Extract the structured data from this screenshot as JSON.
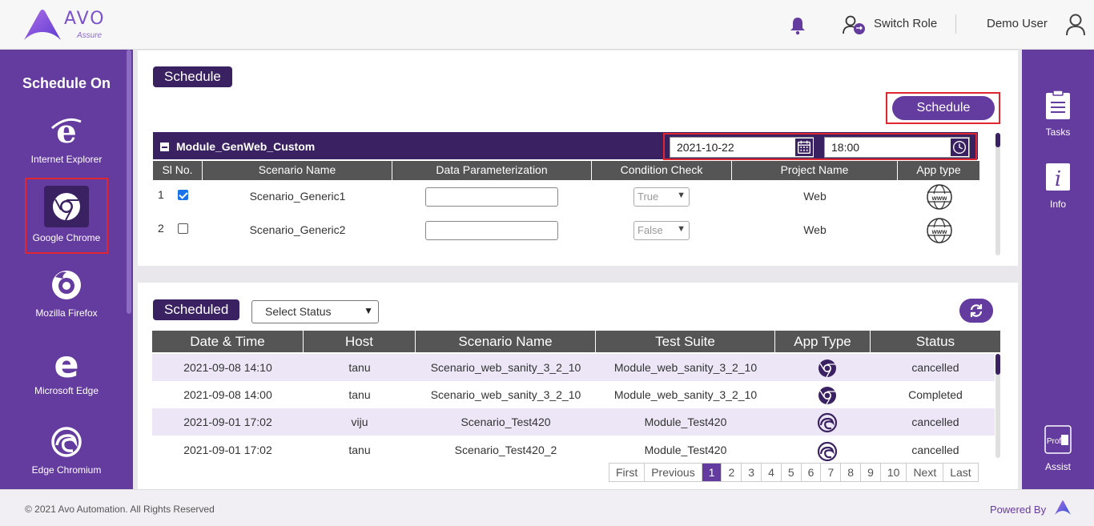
{
  "header": {
    "logo_text": "AVO",
    "logo_sub": "Assure",
    "switch_role": "Switch Role",
    "user_name": "Demo User"
  },
  "left_sidebar": {
    "title": "Schedule On",
    "browsers": [
      {
        "label": "Internet Explorer",
        "icon": "internet-explorer-icon"
      },
      {
        "label": "Google Chrome",
        "icon": "chrome-icon",
        "selected": true
      },
      {
        "label": "Mozilla Firefox",
        "icon": "firefox-icon"
      },
      {
        "label": "Microsoft Edge",
        "icon": "edge-icon"
      },
      {
        "label": "Edge Chromium",
        "icon": "edge-chromium-icon"
      }
    ]
  },
  "right_sidebar": {
    "items": [
      {
        "label": "Tasks",
        "icon": "clipboard-icon"
      },
      {
        "label": "Info",
        "icon": "info-icon"
      },
      {
        "label": "Assist",
        "icon": "proficient-icon",
        "icon_text": "Prof"
      }
    ]
  },
  "schedule_section": {
    "title": "Schedule",
    "schedule_button": "Schedule",
    "module_name": "Module_GenWeb_Custom",
    "date": "2021-10-22",
    "time": "18:00",
    "columns": [
      "Sl No.",
      "Scenario Name",
      "Data Parameterization",
      "Condition Check",
      "Project Name",
      "App type"
    ],
    "rows": [
      {
        "sl": "1",
        "checked": true,
        "scenario": "Scenario_Generic1",
        "data_param": "",
        "condition": "True",
        "project": "Web",
        "app_type": "www"
      },
      {
        "sl": "2",
        "checked": false,
        "scenario": "Scenario_Generic2",
        "data_param": "",
        "condition": "False",
        "project": "Web",
        "app_type": "www"
      }
    ]
  },
  "scheduled_section": {
    "title": "Scheduled",
    "status_select": "Select Status",
    "columns": [
      "Date & Time",
      "Host",
      "Scenario Name",
      "Test Suite",
      "App Type",
      "Status"
    ],
    "rows": [
      {
        "datetime": "2021-09-08 14:10",
        "host": "tanu",
        "scenario": "Scenario_web_sanity_3_2_10",
        "suite": "Module_web_sanity_3_2_10",
        "app": "chrome",
        "status": "cancelled"
      },
      {
        "datetime": "2021-09-08 14:00",
        "host": "tanu",
        "scenario": "Scenario_web_sanity_3_2_10",
        "suite": "Module_web_sanity_3_2_10",
        "app": "chrome",
        "status": "Completed"
      },
      {
        "datetime": "2021-09-01 17:02",
        "host": "viju",
        "scenario": "Scenario_Test420",
        "suite": "Module_Test420",
        "app": "edge-chromium",
        "status": "cancelled"
      },
      {
        "datetime": "2021-09-01 17:02",
        "host": "tanu",
        "scenario": "Scenario_Test420_2",
        "suite": "Module_Test420",
        "app": "edge-chromium",
        "status": "cancelled"
      }
    ],
    "pagination": {
      "first": "First",
      "previous": "Previous",
      "pages": [
        "1",
        "2",
        "3",
        "4",
        "5",
        "6",
        "7",
        "8",
        "9",
        "10"
      ],
      "active_page": "1",
      "next": "Next",
      "last": "Last"
    }
  },
  "footer": {
    "copyright": "© 2021 Avo Automation. All Rights Reserved",
    "powered_by": "Powered By"
  },
  "colors": {
    "primary": "#643b9f",
    "dark": "#3a2162",
    "highlight": "#e0262e",
    "row_alt": "#ece6f7"
  }
}
